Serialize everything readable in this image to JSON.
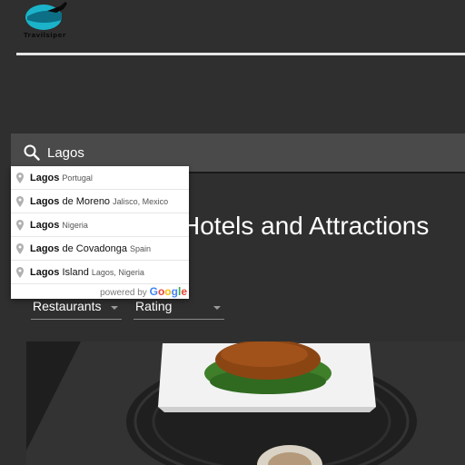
{
  "app": {
    "logo_text": "Travilsiper"
  },
  "search": {
    "value": "Lagos"
  },
  "heading": "Hotels and Attractions",
  "filters": {
    "type_label": "Restaurants",
    "sort_label": "Rating"
  },
  "autocomplete": {
    "items": [
      {
        "main": "Lagos",
        "rest": "",
        "secondary": "Portugal"
      },
      {
        "main": "Lagos",
        "rest": " de Moreno",
        "secondary": "Jalisco, Mexico"
      },
      {
        "main": "Lagos",
        "rest": "",
        "secondary": "Nigeria"
      },
      {
        "main": "Lagos",
        "rest": " de Covadonga",
        "secondary": "Spain"
      },
      {
        "main": "Lagos",
        "rest": " Island",
        "secondary": "Lagos, Nigeria"
      }
    ],
    "powered_by": "powered by",
    "brand": [
      "G",
      "o",
      "o",
      "g",
      "l",
      "e"
    ]
  },
  "colors": {
    "page_bg": "#2f2f2f",
    "search_bg": "#4a4a4a",
    "logo_accent": "#1bb3c9"
  }
}
